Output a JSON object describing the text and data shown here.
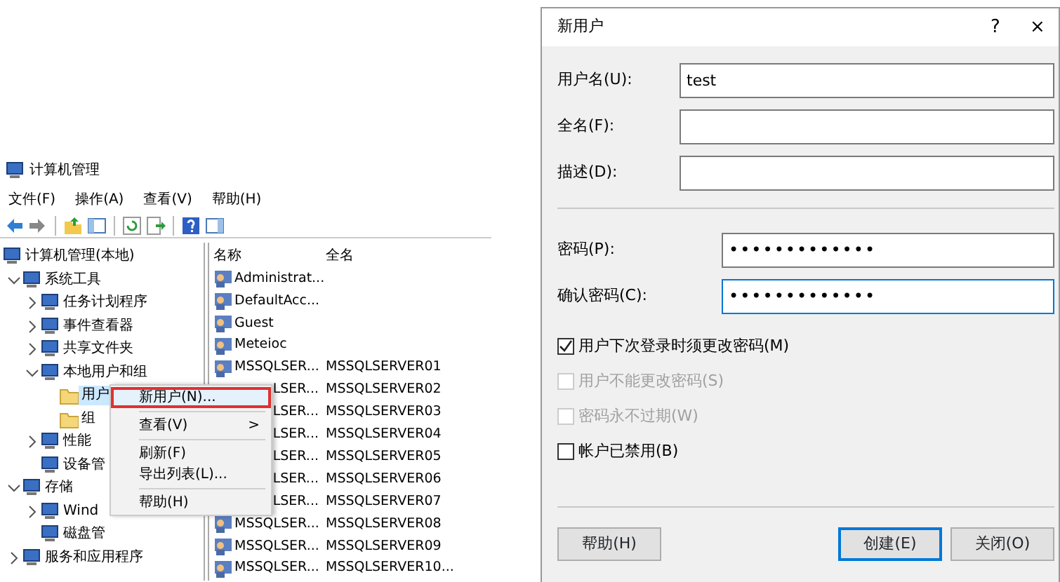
{
  "management_window": {
    "title": "计算机管理",
    "menu": [
      "文件(F)",
      "操作(A)",
      "查看(V)",
      "帮助(H)"
    ],
    "tree": [
      {
        "label": "计算机管理(本地)",
        "selected": false,
        "children": [
          {
            "label": "系统工具",
            "selected": false,
            "expanded": true,
            "children": [
              {
                "label": "任务计划程序",
                "selected": false,
                "expanded": false
              },
              {
                "label": "事件查看器",
                "selected": false,
                "expanded": false
              },
              {
                "label": "共享文件夹",
                "selected": false,
                "expanded": false
              },
              {
                "label": "本地用户和组",
                "selected": false,
                "expanded": true,
                "children": [
                  {
                    "label": "用户",
                    "selected": true
                  },
                  {
                    "label": "组",
                    "selected": false
                  }
                ]
              },
              {
                "label": "性能",
                "selected": false,
                "expanded": false
              },
              {
                "label": "设备管",
                "selected": false
              }
            ]
          },
          {
            "label": "存储",
            "selected": false,
            "expanded": true,
            "children": [
              {
                "label": "Wind",
                "selected": false,
                "expanded": false
              },
              {
                "label": "磁盘管",
                "selected": false
              }
            ]
          },
          {
            "label": "服务和应用程序",
            "selected": false,
            "expanded": false
          }
        ]
      }
    ],
    "columns": [
      "名称",
      "全名"
    ],
    "rows": [
      {
        "name": "Administrat...",
        "under_menu": false
      },
      {
        "name": "DefaultAcc...",
        "under_menu": false
      },
      {
        "name": "Guest",
        "under_menu": false
      },
      {
        "name": "Meteioc",
        "under_menu": false
      },
      {
        "name": "MSSQLSER...",
        "full_name": "MSSQLSERVER01",
        "under_menu": false
      },
      {
        "name": "LSER...",
        "full_name": "MSSQLSERVER02",
        "under_menu": true
      },
      {
        "name": "LSER...",
        "full_name": "MSSQLSERVER03",
        "under_menu": true
      },
      {
        "name": "LSER...",
        "full_name": "MSSQLSERVER04",
        "under_menu": true
      },
      {
        "name": "LSER...",
        "full_name": "MSSQLSERVER05",
        "under_menu": true
      },
      {
        "name": "LSER...",
        "full_name": "MSSQLSERVER06",
        "under_menu": true
      },
      {
        "name": "LSER...",
        "full_name": "MSSQLSERVER07",
        "under_menu": true
      },
      {
        "name": "MSSQLSER...",
        "full_name": "MSSQLSERVER08",
        "under_menu": false
      },
      {
        "name": "MSSQLSER...",
        "full_name": "MSSQLSERVER09",
        "under_menu": false
      },
      {
        "name": "MSSQLSER...",
        "full_name": "MSSQLSERVER10...",
        "under_menu": false
      }
    ],
    "context_menu": [
      {
        "kind": "item",
        "label": "新用户(N)...",
        "highlighted": true
      },
      {
        "kind": "separator"
      },
      {
        "kind": "submenu",
        "label": "查看(V)",
        "arrow": ">",
        "highlighted": false
      },
      {
        "kind": "separator"
      },
      {
        "kind": "item",
        "label": "刷新(F)",
        "highlighted": false
      },
      {
        "kind": "item",
        "label": "导出列表(L)...",
        "highlighted": false
      },
      {
        "kind": "separator"
      },
      {
        "kind": "item",
        "label": "帮助(H)",
        "highlighted": false
      }
    ]
  },
  "dialog": {
    "title": "新用户",
    "title_buttons": [
      "?",
      "×"
    ],
    "fields": [
      {
        "kind": "text",
        "label": "用户名(U):",
        "value": "test",
        "focused": false
      },
      {
        "kind": "text",
        "label": "全名(F):",
        "focused": false
      },
      {
        "kind": "text",
        "label": "描述(D):",
        "focused": false
      },
      {
        "kind": "separator"
      },
      {
        "kind": "password",
        "label": "密码(P):",
        "value": "•••••••••••••",
        "focused": false
      },
      {
        "kind": "password",
        "label": "确认密码(C):",
        "value": "•••••••••••••",
        "focused": true
      }
    ],
    "checkboxes": [
      {
        "label": "用户下次登录时须更改密码(M)",
        "checked": true,
        "disabled": false
      },
      {
        "label": "用户不能更改密码(S)",
        "checked": false,
        "disabled": true
      },
      {
        "label": "密码永不过期(W)",
        "checked": false,
        "disabled": true
      },
      {
        "label": "帐户已禁用(B)",
        "checked": false,
        "disabled": false
      }
    ],
    "buttons": [
      {
        "label": "帮助(H)",
        "default": false
      },
      {
        "label": "创建(E)",
        "default": true
      },
      {
        "label": "关闭(O)",
        "default": false
      }
    ]
  }
}
